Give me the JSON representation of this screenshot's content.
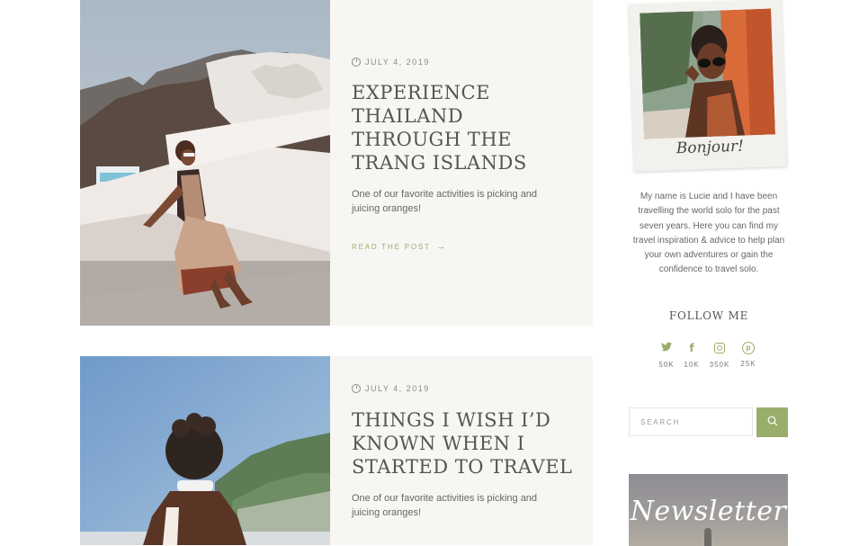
{
  "posts": [
    {
      "date": "JULY 4, 2019",
      "title": "EXPERIENCE THAILAND THROUGH THE TRANG ISLANDS",
      "excerpt": "One of our favorite activities is picking and juicing oranges!",
      "read_more": "READ THE POST"
    },
    {
      "date": "JULY 4, 2019",
      "title": "THINGS I WISH I’D KNOWN WHEN I STARTED TO TRAVEL",
      "excerpt": "One of our favorite activities is picking and juicing oranges!"
    }
  ],
  "sidebar": {
    "polaroid_caption": "Bonjour!",
    "about": "My name is Lucie and I have been travelling the world solo for the past seven years. Here you can find my travel inspiration & advice to help plan your own adventures or gain the confidence to travel solo.",
    "follow_title": "FOLLOW ME",
    "social": [
      {
        "icon": "twitter-icon",
        "count": "50K"
      },
      {
        "icon": "facebook-icon",
        "count": "10K"
      },
      {
        "icon": "instagram-icon",
        "count": "350K"
      },
      {
        "icon": "pinterest-icon",
        "count": "25K"
      }
    ],
    "search": {
      "placeholder": "SEARCH",
      "button_icon": "search-icon"
    },
    "newsletter_title": "Newsletter"
  },
  "colors": {
    "accent": "#9aae6b",
    "card_bg": "#f8f6f3",
    "text": "#555555"
  }
}
